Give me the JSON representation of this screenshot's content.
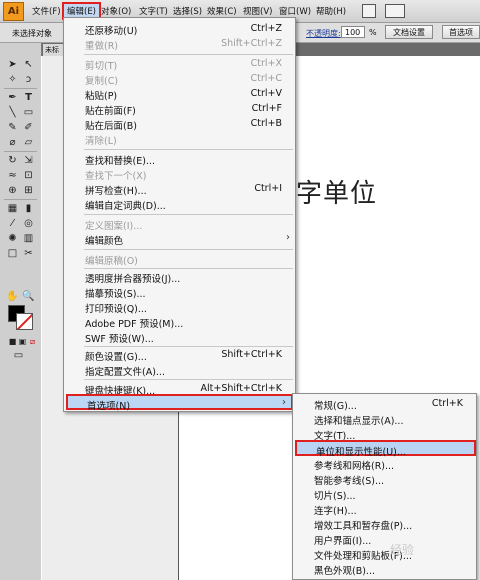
{
  "app": {
    "logo_text": "Ai"
  },
  "menubar": [
    {
      "label": "文件(F)"
    },
    {
      "label": "编辑(E)"
    },
    {
      "label": "对象(O)"
    },
    {
      "label": "文字(T)"
    },
    {
      "label": "选择(S)"
    },
    {
      "label": "效果(C)"
    },
    {
      "label": "视图(V)"
    },
    {
      "label": "窗口(W)"
    },
    {
      "label": "帮助(H)"
    }
  ],
  "control_bar": {
    "selection_status": "未选择对象",
    "opacity_label": "不透明度:",
    "opacity_value": "100",
    "opacity_unit": "%",
    "doc_settings": "文档设置",
    "preferences": "首选项"
  },
  "document_tab": {
    "label": "未标"
  },
  "canvas": {
    "partial_text": "字单位"
  },
  "edit_menu": {
    "items": [
      {
        "label": "还原移动(U)",
        "shortcut": "Ctrl+Z",
        "enabled": true
      },
      {
        "label": "重做(R)",
        "shortcut": "Shift+Ctrl+Z",
        "enabled": false
      },
      {
        "label": "剪切(T)",
        "shortcut": "Ctrl+X",
        "enabled": false
      },
      {
        "label": "复制(C)",
        "shortcut": "Ctrl+C",
        "enabled": false
      },
      {
        "label": "粘贴(P)",
        "shortcut": "Ctrl+V",
        "enabled": true
      },
      {
        "label": "贴在前面(F)",
        "shortcut": "Ctrl+F",
        "enabled": true
      },
      {
        "label": "贴在后面(B)",
        "shortcut": "Ctrl+B",
        "enabled": true
      },
      {
        "label": "清除(L)",
        "shortcut": "",
        "enabled": false
      },
      {
        "label": "查找和替换(E)...",
        "shortcut": "",
        "enabled": true
      },
      {
        "label": "查找下一个(X)",
        "shortcut": "",
        "enabled": false
      },
      {
        "label": "拼写检查(H)...",
        "shortcut": "Ctrl+I",
        "enabled": true
      },
      {
        "label": "编辑自定词典(D)...",
        "shortcut": "",
        "enabled": true
      },
      {
        "label": "定义图案(I)...",
        "shortcut": "",
        "enabled": false
      },
      {
        "label": "编辑颜色",
        "shortcut": "",
        "enabled": true
      },
      {
        "label": "编辑原稿(O)",
        "shortcut": "",
        "enabled": false
      },
      {
        "label": "透明度拼合器预设(J)...",
        "shortcut": "",
        "enabled": true
      },
      {
        "label": "描摹预设(S)...",
        "shortcut": "",
        "enabled": true
      },
      {
        "label": "打印预设(Q)...",
        "shortcut": "",
        "enabled": true
      },
      {
        "label": "Adobe PDF 预设(M)...",
        "shortcut": "",
        "enabled": true
      },
      {
        "label": "SWF 预设(W)...",
        "shortcut": "",
        "enabled": true
      },
      {
        "label": "颜色设置(G)...",
        "shortcut": "Shift+Ctrl+K",
        "enabled": true
      },
      {
        "label": "指定配置文件(A)...",
        "shortcut": "",
        "enabled": true
      },
      {
        "label": "键盘快捷键(K)...",
        "shortcut": "Alt+Shift+Ctrl+K",
        "enabled": true
      },
      {
        "label": "首选项(N)",
        "shortcut": "",
        "enabled": true
      }
    ]
  },
  "pref_menu": {
    "items": [
      {
        "label": "常规(G)...",
        "shortcut": "Ctrl+K"
      },
      {
        "label": "选择和锚点显示(A)...",
        "shortcut": ""
      },
      {
        "label": "文字(T)...",
        "shortcut": ""
      },
      {
        "label": "单位和显示性能(U)...",
        "shortcut": ""
      },
      {
        "label": "参考线和网格(R)...",
        "shortcut": ""
      },
      {
        "label": "智能参考线(S)...",
        "shortcut": ""
      },
      {
        "label": "切片(S)...",
        "shortcut": ""
      },
      {
        "label": "连字(H)...",
        "shortcut": ""
      },
      {
        "label": "增效工具和暂存盘(P)...",
        "shortcut": ""
      },
      {
        "label": "用户界面(I)...",
        "shortcut": ""
      },
      {
        "label": "文件处理和剪贴板(F)...",
        "shortcut": ""
      },
      {
        "label": "黑色外观(B)...",
        "shortcut": ""
      }
    ]
  },
  "watermark": "经验",
  "colors": {
    "highlight": "#bcd6f5",
    "annotation_red": "#e0201f",
    "logo": "#f29a1d"
  }
}
